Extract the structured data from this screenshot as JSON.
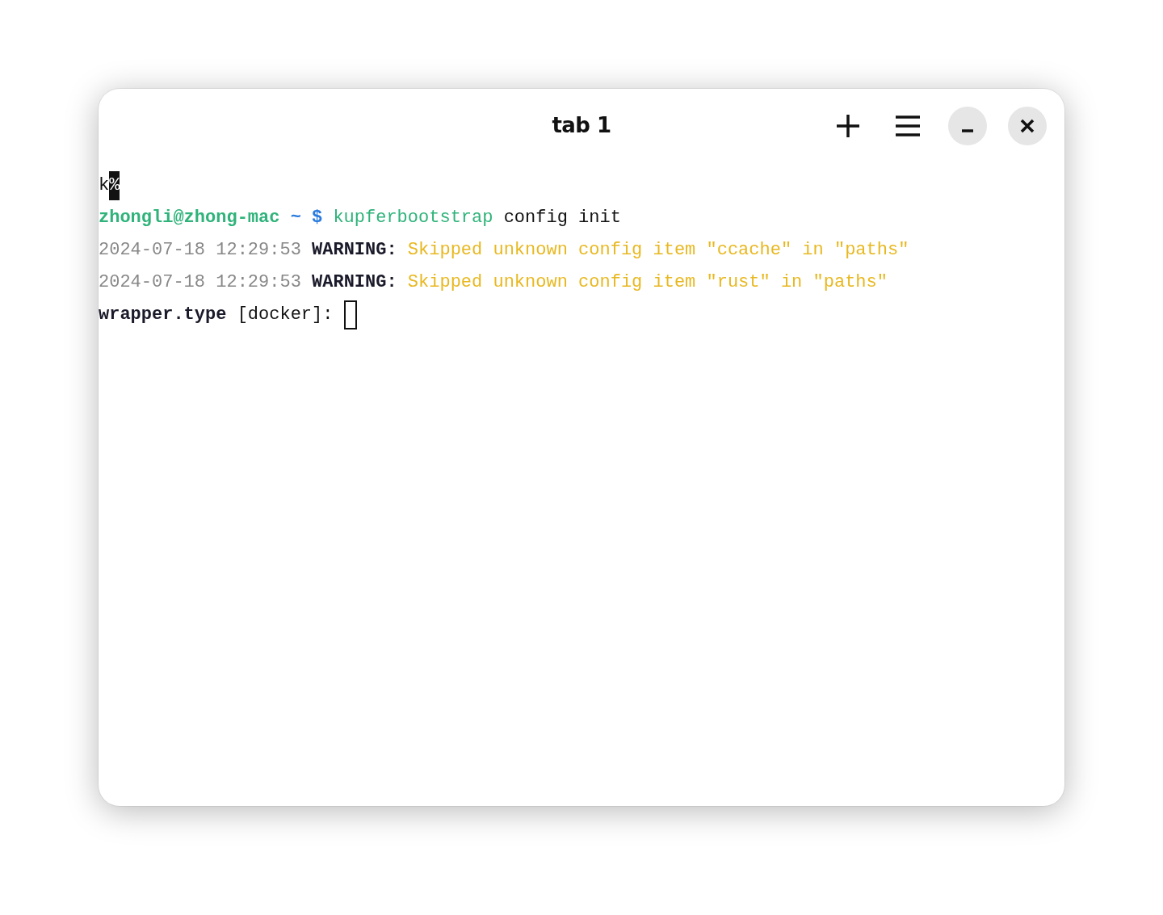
{
  "window": {
    "title": "tab 1"
  },
  "terminal": {
    "lines": [
      {
        "segments": [
          {
            "kind": "plain",
            "text": "k"
          },
          {
            "kind": "inverse",
            "text": "%"
          }
        ]
      },
      {
        "segments": [
          {
            "kind": "user",
            "text": "zhongli@zhong-mac"
          },
          {
            "kind": "path",
            "text": "~"
          },
          {
            "kind": "symbol",
            "text": "$"
          },
          {
            "kind": "command",
            "text": "kupferbootstrap"
          },
          {
            "kind": "plain",
            "text": "config init"
          }
        ]
      },
      {
        "segments": [
          {
            "kind": "timestamp",
            "text": "2024-07-18 12:29:53"
          },
          {
            "kind": "label",
            "text": "WARNING:"
          },
          {
            "kind": "warning",
            "text": "Skipped unknown config item \"ccache\" in \"paths\""
          }
        ]
      },
      {
        "segments": [
          {
            "kind": "timestamp",
            "text": "2024-07-18 12:29:53"
          },
          {
            "kind": "label",
            "text": "WARNING:"
          },
          {
            "kind": "warning",
            "text": "Skipped unknown config item \"rust\" in \"paths\""
          }
        ]
      },
      {
        "segments": [
          {
            "kind": "label",
            "text": "wrapper.type"
          },
          {
            "kind": "plain",
            "text": "[docker]:"
          }
        ],
        "cursor": true
      }
    ]
  }
}
